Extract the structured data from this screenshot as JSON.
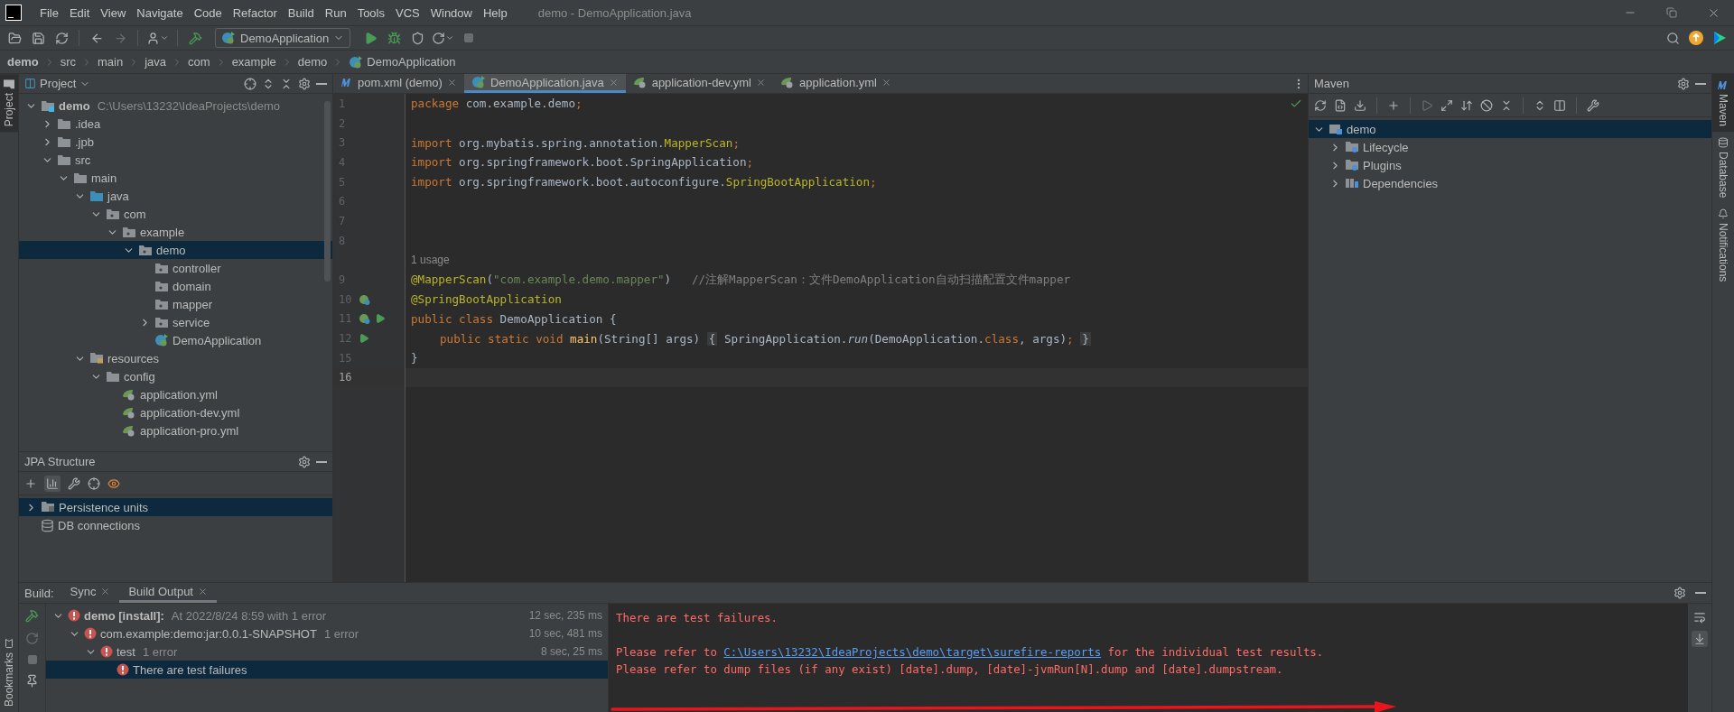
{
  "menu": [
    "File",
    "Edit",
    "View",
    "Navigate",
    "Code",
    "Refactor",
    "Build",
    "Run",
    "Tools",
    "VCS",
    "Window",
    "Help"
  ],
  "window_title": "demo - DemoApplication.java",
  "run_config": "DemoApplication",
  "breadcrumbs": [
    {
      "label": "demo",
      "kind": "root"
    },
    {
      "label": "src",
      "kind": "dir"
    },
    {
      "label": "main",
      "kind": "dir"
    },
    {
      "label": "java",
      "kind": "dir"
    },
    {
      "label": "com",
      "kind": "dir"
    },
    {
      "label": "example",
      "kind": "dir"
    },
    {
      "label": "demo",
      "kind": "dir"
    },
    {
      "label": "DemoApplication",
      "kind": "class"
    }
  ],
  "left_stripe": [
    {
      "label": "Project",
      "selected": true
    },
    {
      "label": "Bookmarks",
      "selected": false
    }
  ],
  "right_stripe": [
    {
      "label": "Maven",
      "selected": true
    },
    {
      "label": "Database",
      "selected": false
    },
    {
      "label": "Notifications",
      "selected": false
    }
  ],
  "project_panel": {
    "title": "Project",
    "tree": [
      {
        "label": "demo",
        "path": "C:\\Users\\13232\\IdeaProjects\\demo",
        "kind": "module",
        "expanded": true,
        "selected": false,
        "children": [
          {
            "label": ".idea",
            "kind": "folder",
            "expanded": false,
            "selected": false
          },
          {
            "label": ".jpb",
            "kind": "folder",
            "expanded": false,
            "selected": false
          },
          {
            "label": "src",
            "kind": "folder",
            "expanded": true,
            "selected": false,
            "children": [
              {
                "label": "main",
                "kind": "folder",
                "expanded": true,
                "selected": false,
                "children": [
                  {
                    "label": "java",
                    "kind": "source",
                    "expanded": true,
                    "selected": false,
                    "children": [
                      {
                        "label": "com",
                        "kind": "package",
                        "expanded": true,
                        "selected": false,
                        "children": [
                          {
                            "label": "example",
                            "kind": "package",
                            "expanded": true,
                            "selected": false,
                            "children": [
                              {
                                "label": "demo",
                                "kind": "package",
                                "expanded": true,
                                "selected": true,
                                "children": [
                                  {
                                    "label": "controller",
                                    "kind": "package",
                                    "selected": false
                                  },
                                  {
                                    "label": "domain",
                                    "kind": "package",
                                    "selected": false
                                  },
                                  {
                                    "label": "mapper",
                                    "kind": "package",
                                    "selected": false
                                  },
                                  {
                                    "label": "service",
                                    "kind": "package",
                                    "expanded": false,
                                    "selected": false
                                  },
                                  {
                                    "label": "DemoApplication",
                                    "kind": "spring-class",
                                    "selected": false
                                  }
                                ]
                              }
                            ]
                          }
                        ]
                      }
                    ]
                  },
                  {
                    "label": "resources",
                    "kind": "resources",
                    "expanded": true,
                    "selected": false,
                    "children": [
                      {
                        "label": "config",
                        "kind": "folder",
                        "expanded": true,
                        "selected": false,
                        "children": [
                          {
                            "label": "application.yml",
                            "kind": "yml",
                            "selected": false
                          },
                          {
                            "label": "application-dev.yml",
                            "kind": "yml",
                            "selected": false
                          },
                          {
                            "label": "application-pro.yml",
                            "kind": "yml",
                            "selected": false
                          }
                        ]
                      }
                    ]
                  }
                ]
              }
            ]
          }
        ]
      }
    ]
  },
  "jpa_structure": {
    "title": "JPA Structure",
    "items": [
      {
        "label": "Persistence units",
        "kind": "persistence",
        "expanded": false,
        "selected": true
      },
      {
        "label": "DB connections",
        "kind": "db",
        "selected": false
      }
    ]
  },
  "editor_tabs": [
    {
      "label": "pom.xml (demo)",
      "kind": "maven",
      "selected": false
    },
    {
      "label": "DemoApplication.java",
      "kind": "spring-class",
      "selected": true
    },
    {
      "label": "application-dev.yml",
      "kind": "yml",
      "selected": false
    },
    {
      "label": "application.yml",
      "kind": "yml",
      "selected": false
    }
  ],
  "code_lines": [
    {
      "number": "1",
      "tokens": [
        {
          "t": "package",
          "kind": "keyword"
        },
        {
          "t": " com.example.demo",
          "kind": "plain"
        },
        {
          "t": ";",
          "kind": "keyword"
        }
      ]
    },
    {
      "number": "2"
    },
    {
      "number": "3",
      "tokens": [
        {
          "t": "import",
          "kind": "keyword"
        },
        {
          "t": " org.mybatis.spring.annotation.",
          "kind": "plain"
        },
        {
          "t": "MapperScan",
          "kind": "annotation"
        },
        {
          "t": ";",
          "kind": "keyword"
        }
      ]
    },
    {
      "number": "4",
      "tokens": [
        {
          "t": "import",
          "kind": "keyword"
        },
        {
          "t": " org.springframework.boot.SpringApplication",
          "kind": "plain"
        },
        {
          "t": ";",
          "kind": "keyword"
        }
      ]
    },
    {
      "number": "5",
      "tokens": [
        {
          "t": "import",
          "kind": "keyword"
        },
        {
          "t": " org.springframework.boot.autoconfigure.",
          "kind": "plain"
        },
        {
          "t": "SpringBootApplication",
          "kind": "annotation"
        },
        {
          "t": ";",
          "kind": "keyword"
        }
      ]
    },
    {
      "number": "6"
    },
    {
      "number": "7"
    },
    {
      "number": "8"
    },
    {
      "hint": "1 usage"
    },
    {
      "number": "9",
      "tokens": [
        {
          "t": "@MapperScan",
          "kind": "annotation"
        },
        {
          "t": "(",
          "kind": "plain"
        },
        {
          "t": "\"com.example.demo.mapper\"",
          "kind": "string"
        },
        {
          "t": ")   ",
          "kind": "plain"
        },
        {
          "t": "//注解MapperScan：文件DemoApplication自动扫描配置文件mapper",
          "kind": "comment"
        }
      ]
    },
    {
      "number": "10",
      "gutter": [
        {
          "kind": "bean"
        }
      ],
      "tokens": [
        {
          "t": "@SpringBootApplication",
          "kind": "annotation"
        }
      ]
    },
    {
      "number": "11",
      "gutter": [
        {
          "kind": "bean"
        },
        {
          "kind": "run"
        }
      ],
      "tokens": [
        {
          "t": "public class",
          "kind": "keyword"
        },
        {
          "t": " DemoApplication {",
          "kind": "plain"
        }
      ]
    },
    {
      "number": "12",
      "gutter": [
        {
          "kind": "run"
        }
      ],
      "indent": true,
      "tokens": [
        {
          "t": "public static void",
          "kind": "keyword"
        },
        {
          "t": " main",
          "kind": "method"
        },
        {
          "t": "(String[] args) ",
          "kind": "plain"
        },
        {
          "t": "{",
          "kind": "folded"
        },
        {
          "t": " SpringApplication.",
          "kind": "plain"
        },
        {
          "t": "run",
          "kind": "static"
        },
        {
          "t": "(DemoApplication.",
          "kind": "plain"
        },
        {
          "t": "class",
          "kind": "keyword"
        },
        {
          "t": ", args)",
          "kind": "plain"
        },
        {
          "t": "; ",
          "kind": "keyword"
        },
        {
          "t": "}",
          "kind": "folded"
        }
      ]
    },
    {
      "number": "15",
      "tokens": [
        {
          "t": "}",
          "kind": "plain"
        }
      ]
    },
    {
      "number": "16",
      "current": true
    }
  ],
  "maven": {
    "title": "Maven",
    "tree": [
      {
        "label": "demo",
        "kind": "mvn-project",
        "expanded": true,
        "selected": true,
        "children": [
          {
            "label": "Lifecycle",
            "kind": "mvn-folder",
            "expanded": false,
            "selected": false
          },
          {
            "label": "Plugins",
            "kind": "mvn-folder",
            "expanded": false,
            "selected": false
          },
          {
            "label": "Dependencies",
            "kind": "mvn-deps",
            "expanded": false,
            "selected": false
          }
        ]
      }
    ]
  },
  "build": {
    "label": "Build:",
    "tabs": [
      {
        "label": "Sync",
        "selected": false
      },
      {
        "label": "Build Output",
        "selected": true
      }
    ],
    "tree": [
      {
        "label": "demo [install]:",
        "detail": "At 2022/8/24 8:59 with 1 error",
        "time": "12 sec, 235 ms",
        "bold": true,
        "expanded": true,
        "selected": false,
        "children": [
          {
            "label": "com.example:demo:jar:0.0.1-SNAPSHOT",
            "detail": "1 error",
            "time": "10 sec, 481 ms",
            "bold": false,
            "expanded": true,
            "selected": false,
            "children": [
              {
                "label": "test",
                "detail": "1 error",
                "time": "8 sec, 25 ms",
                "bold": false,
                "expanded": true,
                "selected": false,
                "children": [
                  {
                    "label": "There are test failures",
                    "bold": false,
                    "selected": true
                  }
                ]
              }
            ]
          }
        ]
      }
    ],
    "console": [
      {
        "parts": [
          {
            "text": "There are test failures."
          }
        ]
      },
      {
        "blank_before": true,
        "parts": [
          {
            "text": "Please refer to "
          },
          {
            "text": "C:\\Users\\13232\\IdeaProjects\\demo\\target\\surefire-reports",
            "link": true
          },
          {
            "text": " for the individual test results."
          }
        ]
      },
      {
        "parts": [
          {
            "text": "Please refer to dump files (if any exist) [date].dump, [date]-jvmRun[N].dump and [date].dumpstream."
          }
        ]
      }
    ]
  }
}
